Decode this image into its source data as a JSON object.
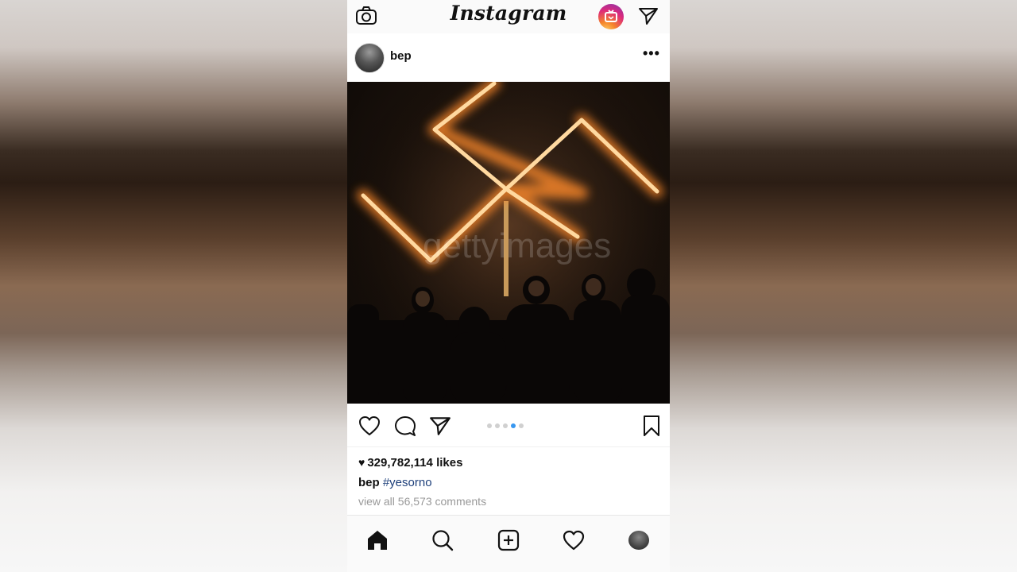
{
  "app": {
    "title": "Instagram"
  },
  "post": {
    "username": "bep",
    "more_label": "•••",
    "image_watermark": "gettyimages",
    "carousel": {
      "count": 5,
      "active_index": 3
    },
    "likes": "329,782,114 likes",
    "caption_user": "bep",
    "caption_tag": "#yesorno",
    "view_comments": "view all 56,573 comments"
  },
  "icons": {
    "camera": "camera-icon",
    "igtv": "igtv-icon",
    "direct": "paper-plane-icon",
    "like": "heart-icon",
    "comment": "comment-icon",
    "share": "paper-plane-icon",
    "save": "bookmark-icon",
    "home": "home-icon",
    "search": "search-icon",
    "new_post": "plus-square-icon",
    "activity": "heart-icon",
    "profile": "avatar-icon"
  },
  "colors": {
    "link": "#1d3f7a",
    "carousel_active": "#3897f0",
    "muted_text": "#999999"
  }
}
